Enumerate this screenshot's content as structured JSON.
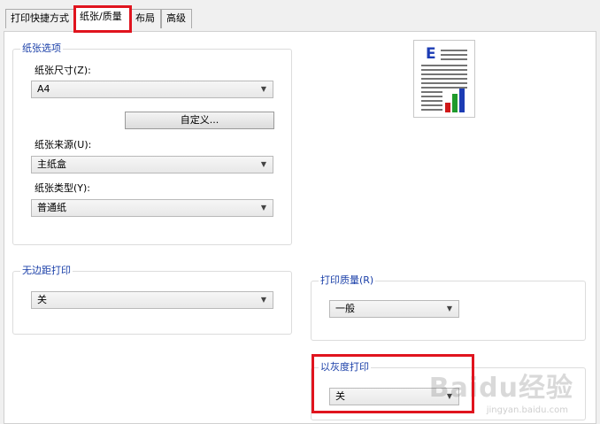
{
  "tabs": [
    {
      "label": "打印快捷方式"
    },
    {
      "label": "纸张/质量"
    },
    {
      "label": "布局"
    },
    {
      "label": "高级"
    }
  ],
  "paper_options": {
    "legend": "纸张选项",
    "size_label": "纸张尺寸(Z):",
    "size_value": "A4",
    "custom_button": "自定义...",
    "source_label": "纸张来源(U):",
    "source_value": "主纸盒",
    "type_label": "纸张类型(Y):",
    "type_value": "普通纸"
  },
  "borderless": {
    "legend": "无边距打印",
    "value": "关"
  },
  "print_quality": {
    "legend": "打印质量(R)",
    "value": "一般"
  },
  "grayscale": {
    "legend": "以灰度打印",
    "value": "关"
  },
  "preview": {
    "letter": "E",
    "bar_colors": [
      "#d01818",
      "#1f9a2c",
      "#1c3cb4"
    ]
  },
  "watermark": {
    "text": "Baidu经验",
    "sub": "jingyan.baidu.com"
  },
  "highlight_color": "#e0141e"
}
